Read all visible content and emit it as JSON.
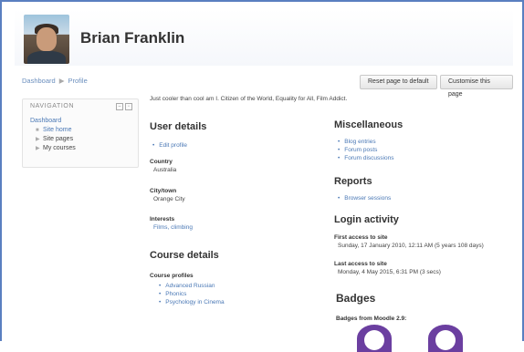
{
  "header": {
    "user_name": "Brian Franklin"
  },
  "breadcrumb": {
    "items": [
      "Dashboard",
      "Profile"
    ]
  },
  "buttons": {
    "reset": "Reset page to default",
    "customise": "Customise this page"
  },
  "navigation": {
    "title": "NAVIGATION",
    "root": "Dashboard",
    "items": [
      {
        "label": "Site home"
      },
      {
        "label": "Site pages"
      },
      {
        "label": "My courses"
      }
    ]
  },
  "intro_text": "Just cooler than cool am I. Citizen of the World, Equality for All, Film Addict.",
  "user_details": {
    "title": "User details",
    "edit_link": "Edit profile",
    "country_label": "Country",
    "country_value": "Australia",
    "city_label": "City/town",
    "city_value": "Orange City",
    "interests_label": "Interests",
    "interests_value": "Films, climbing"
  },
  "course_details": {
    "title": "Course details",
    "profiles_label": "Course profiles",
    "courses": [
      "Advanced Russian",
      "Phonics",
      "Psychology in Cinema"
    ]
  },
  "miscellaneous": {
    "title": "Miscellaneous",
    "links": [
      "Blog entries",
      "Forum posts",
      "Forum discussions"
    ]
  },
  "reports": {
    "title": "Reports",
    "links": [
      "Browser sessions"
    ]
  },
  "login_activity": {
    "title": "Login activity",
    "first_label": "First access to site",
    "first_value": "Sunday, 17 January 2010, 12:11 AM  (5 years 108 days)",
    "last_label": "Last access to site",
    "last_value": "Monday, 4 May 2015, 6:31 PM  (3 secs)"
  },
  "badges": {
    "title": "Badges",
    "from_label": "Badges from Moodle 2.9:"
  },
  "colors": {
    "frame_border": "#5a7fc0",
    "link": "#4a78b5",
    "badge": "#6b3fa0"
  }
}
